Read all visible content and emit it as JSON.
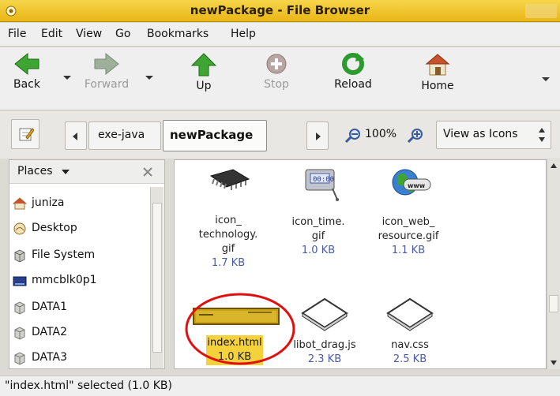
{
  "window": {
    "title": "newPackage - File Browser"
  },
  "menu": [
    "File",
    "Edit",
    "View",
    "Go",
    "Bookmarks",
    "Help"
  ],
  "toolbar": {
    "back": "Back",
    "forward": "Forward",
    "up": "Up",
    "stop": "Stop",
    "reload": "Reload",
    "home": "Home"
  },
  "location": {
    "crumbs": [
      "exe-java",
      "newPackage"
    ],
    "zoom": "100%",
    "view_mode": "View as Icons"
  },
  "sidebar": {
    "header": "Places",
    "items": [
      {
        "label": "juniza",
        "icon": "home-folder-icon"
      },
      {
        "label": "Desktop",
        "icon": "desktop-icon"
      },
      {
        "label": "File System",
        "icon": "filesystem-icon"
      },
      {
        "label": "mmcblk0p1",
        "icon": "drive-icon"
      },
      {
        "label": "DATA1",
        "icon": "disk-icon"
      },
      {
        "label": "DATA2",
        "icon": "disk-icon"
      },
      {
        "label": "DATA3",
        "icon": "disk-icon"
      }
    ]
  },
  "files": [
    {
      "name_lines": [
        "icon_",
        "technology.",
        "gif"
      ],
      "size": "1.7 KB"
    },
    {
      "name_lines": [
        "icon_time.",
        "gif"
      ],
      "size": "1.0 KB"
    },
    {
      "name_lines": [
        "icon_web_",
        "resource.gif"
      ],
      "size": "1.1 KB"
    },
    {
      "name_lines": [
        "index.html"
      ],
      "size": "1.0 KB",
      "selected": true
    },
    {
      "name_lines": [
        "libot_drag.js"
      ],
      "size": "2.3 KB"
    },
    {
      "name_lines": [
        "nav.css"
      ],
      "size": "2.5 KB"
    }
  ],
  "status": "\"index.html\" selected (1.0 KB)",
  "colors": {
    "titlebar": "#f0c530",
    "selection": "#f5d23c",
    "annotation": "#e01010",
    "size_text": "#4a5aa8"
  }
}
